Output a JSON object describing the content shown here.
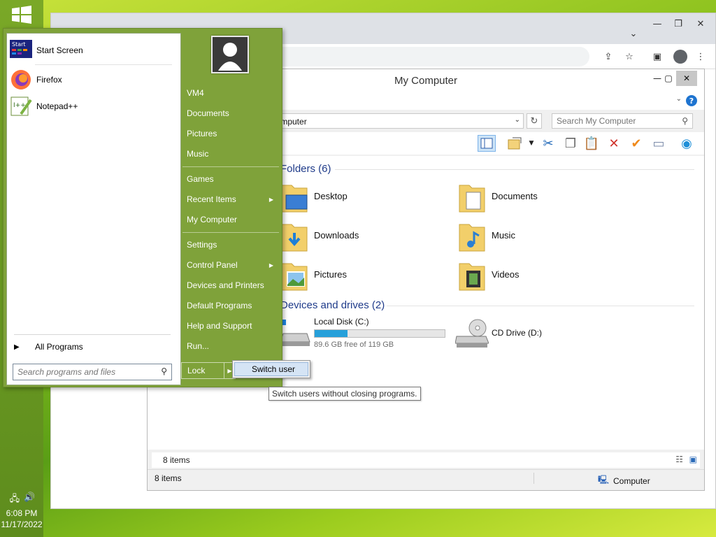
{
  "taskbar": {
    "time": "6:08 PM",
    "date": "11/17/2022",
    "tray_icons": [
      "network-icon",
      "speaker-icon"
    ]
  },
  "explorer": {
    "title": "My Computer",
    "address": "Computer",
    "search_placeholder": "Search My Computer",
    "groups": {
      "folders_header": "Folders (6)",
      "devices_header": "Devices and drives (2)"
    },
    "folders": [
      {
        "label": "Desktop",
        "icon": "desktop-folder-icon"
      },
      {
        "label": "Documents",
        "icon": "documents-folder-icon"
      },
      {
        "label": "Downloads",
        "icon": "downloads-folder-icon"
      },
      {
        "label": "Music",
        "icon": "music-folder-icon"
      },
      {
        "label": "Pictures",
        "icon": "pictures-folder-icon"
      },
      {
        "label": "Videos",
        "icon": "videos-folder-icon"
      }
    ],
    "drives": [
      {
        "label": "Local Disk (C:)",
        "free_text": "89.6 GB free of 119 GB",
        "used_fraction": 0.25
      },
      {
        "label": "CD Drive (D:)"
      }
    ],
    "status_inner": "8 items",
    "status_left": "8 items",
    "status_right": "Computer",
    "colors": {
      "accent": "#1f3b8a",
      "drive_bar": "#26a0da"
    }
  },
  "start_menu": {
    "pinned": [
      {
        "label": "Start Screen",
        "icon": "start-screen-icon"
      },
      {
        "label": "Firefox",
        "icon": "firefox-icon"
      },
      {
        "label": "Notepad++",
        "icon": "notepadpp-icon"
      }
    ],
    "all_programs": "All Programs",
    "search_placeholder": "Search programs and files",
    "right_items": {
      "user": "VM4",
      "documents": "Documents",
      "pictures": "Pictures",
      "music": "Music",
      "games": "Games",
      "recent": "Recent Items",
      "computer": "My Computer",
      "settings": "Settings",
      "control_panel": "Control Panel",
      "devices": "Devices and Printers",
      "default_programs": "Default Programs",
      "help": "Help and Support",
      "run": "Run..."
    },
    "lock_label": "Lock",
    "switch_user": "Switch user",
    "tooltip": "Switch users without closing programs.",
    "colors": {
      "menu_bg": "#7fa23a"
    }
  }
}
